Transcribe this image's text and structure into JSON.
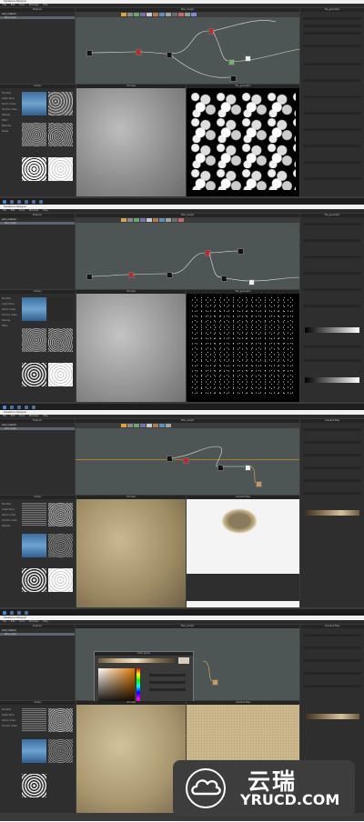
{
  "app": {
    "window_title": "Substance Designer",
    "menu": [
      "File",
      "Edit",
      "Tools",
      "Windows",
      "Help"
    ]
  },
  "panels": {
    "explorer": "Explorer",
    "graph": "Main_Graph",
    "library": "Library",
    "view3d": "3D View",
    "view2d_a": "Tile_generator",
    "view2d_b": "Gradient Map",
    "properties_a": "Tile_generator",
    "properties_b": "Gradient Map",
    "color_picker": "Color picker"
  },
  "library_items": [
    "Favorites",
    "Graph items",
    "Atomic nodes",
    "Function nodes",
    "Textures",
    "Filters",
    "Materials",
    "Noises",
    "PBR Materials",
    "MDL Resources",
    "mdl",
    "3D"
  ],
  "explorer_item": "sand_material",
  "explorer_sub": "Main_Graph",
  "colors": {
    "accent": "#4a90d9",
    "node_red": "#c0292b",
    "graph_bg": "#4d5654",
    "panel_bg": "#2e2e2e"
  },
  "watermark": {
    "cn": "云瑞",
    "en": "YRUCD.COM"
  }
}
